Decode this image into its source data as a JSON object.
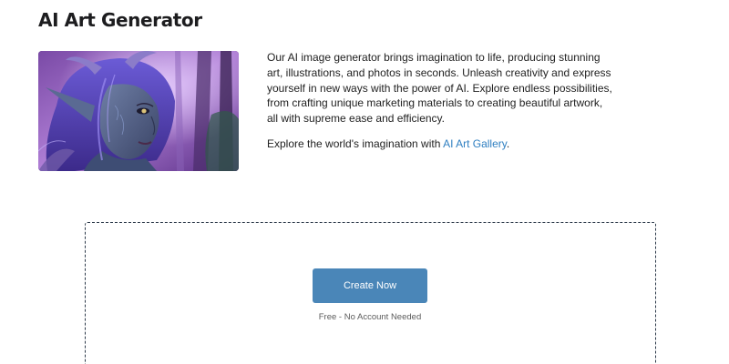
{
  "page": {
    "title": "AI Art Generator"
  },
  "hero": {
    "image_alt": "Fantasy elf woman with purple hair and pointed ears in a purple forest"
  },
  "intro": {
    "paragraph": "Our AI image generator brings imagination to life, producing stunning art, illustrations, and photos in seconds. Unleash creativity and express yourself in new ways with the power of AI. Explore endless possibilities, from crafting unique marketing materials to creating beautiful artwork, all with supreme ease and efficiency.",
    "gallery_prefix": "Explore the world's imagination with ",
    "gallery_link": "AI Art Gallery",
    "gallery_suffix": "."
  },
  "generator": {
    "create_label": "Create Now",
    "free_note": "Free - No Account Needed"
  },
  "colors": {
    "button": "#4a86b8",
    "link": "#2f7fc1",
    "dash_border": "#2d3a4a"
  }
}
